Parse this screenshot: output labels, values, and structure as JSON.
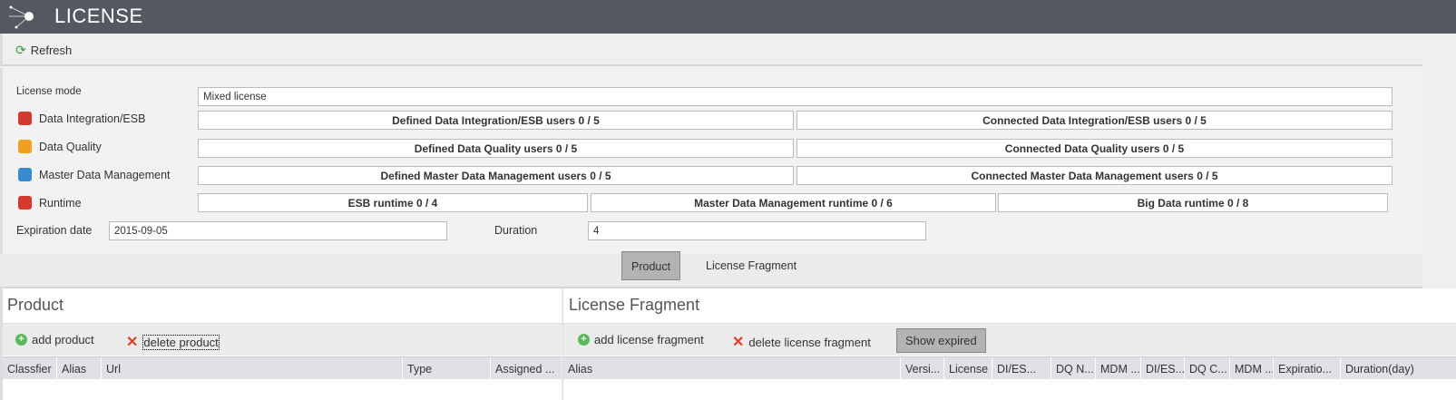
{
  "header": {
    "title": "LICENSE"
  },
  "toolbar": {
    "refresh": "Refresh"
  },
  "form": {
    "license_mode_label": "License mode",
    "license_mode_value": "Mixed license",
    "rows": [
      {
        "label": "Data Integration/ESB",
        "color": "#d43b30",
        "fields": [
          "Defined Data Integration/ESB users 0 / 5",
          "Connected Data Integration/ESB users 0 / 5"
        ]
      },
      {
        "label": "Data Quality",
        "color": "#f0a020",
        "fields": [
          "Defined Data Quality users 0 / 5",
          "Connected Data Quality users 0 / 5"
        ]
      },
      {
        "label": "Master Data Management",
        "color": "#3a8ad0",
        "fields": [
          "Defined Master Data Management users 0 / 5",
          "Connected Master Data Management users 0 / 5"
        ]
      },
      {
        "label": "Runtime",
        "color": "#d43b30",
        "fields": [
          "ESB runtime 0 / 4",
          "Master Data Management runtime 0 / 6",
          "Big Data runtime 0 / 8"
        ]
      }
    ],
    "expiration_label": "Expiration date",
    "expiration_value": "2015-09-05",
    "duration_label": "Duration",
    "duration_value": "4"
  },
  "tabs": [
    "Product",
    "License Fragment"
  ],
  "product": {
    "title": "Product",
    "add": "add product",
    "delete": "delete product",
    "columns": [
      "Classfier",
      "Alias",
      "Url",
      "Type",
      "Assigned ..."
    ]
  },
  "fragment": {
    "title": "License Fragment",
    "add": "add license fragment",
    "delete": "delete license fragment",
    "show_expired": "Show expired",
    "columns": [
      "Alias",
      "Versi...",
      "License ...",
      "DI/ES...",
      "DQ N...",
      "MDM ...",
      "DI/ES...",
      "DQ C...",
      "MDM ...",
      "Expiratio...",
      "Duration(day)"
    ]
  }
}
